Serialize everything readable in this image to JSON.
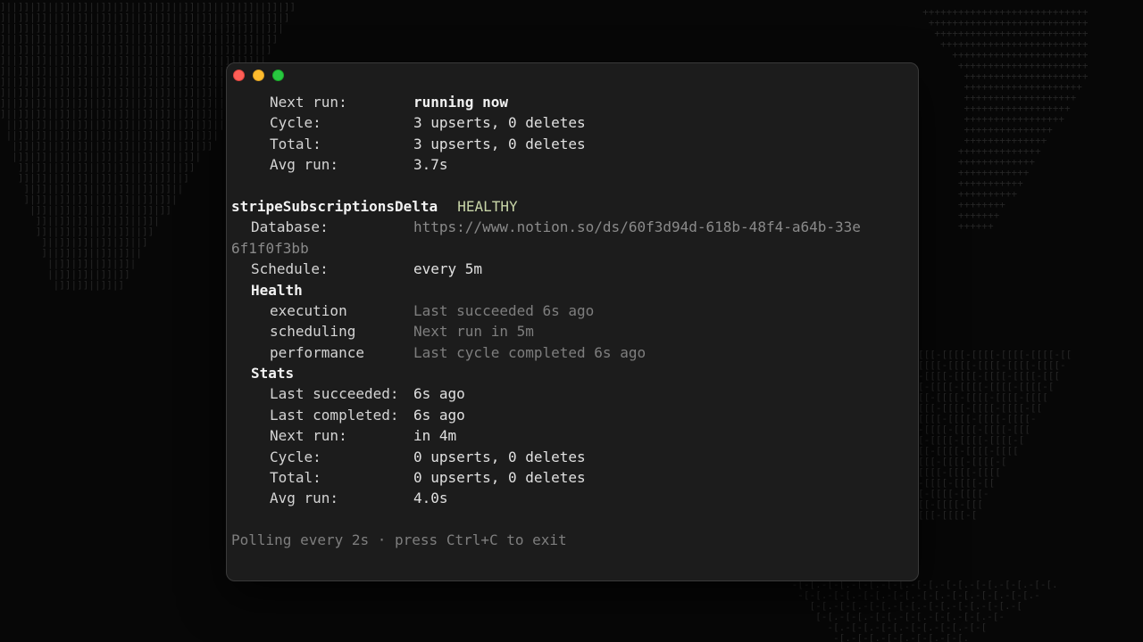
{
  "window": {
    "controls": [
      "close",
      "minimize",
      "zoom"
    ]
  },
  "prev_stats": {
    "next_run": {
      "key": "Next run:",
      "value": "running now"
    },
    "cycle": {
      "key": "Cycle:",
      "value": "3 upserts, 0 deletes"
    },
    "total": {
      "key": "Total:",
      "value": "3 upserts, 0 deletes"
    },
    "avg_run": {
      "key": "Avg run:",
      "value": "3.7s"
    }
  },
  "job": {
    "name": "stripeSubscriptionsDelta",
    "status": "HEALTHY",
    "status_color": "#c8d5a8",
    "database": {
      "key": "Database:",
      "url_line1": "https://www.notion.so/ds/60f3d94d-618b-48f4-a64b-33e",
      "url_line2": "6f1f0f3bb"
    },
    "schedule": {
      "key": "Schedule:",
      "value": "every 5m"
    },
    "health": {
      "heading": "Health",
      "execution": {
        "key": "execution",
        "value": "Last succeeded 6s ago"
      },
      "scheduling": {
        "key": "scheduling",
        "value": "Next run in 5m"
      },
      "performance": {
        "key": "performance",
        "value": "Last cycle completed 6s ago"
      }
    },
    "stats": {
      "heading": "Stats",
      "last_succeeded": {
        "key": "Last succeeded:",
        "value": "6s ago"
      },
      "last_completed": {
        "key": "Last completed:",
        "value": "6s ago"
      },
      "next_run": {
        "key": "Next run:",
        "value": "in 4m"
      },
      "cycle": {
        "key": "Cycle:",
        "value": "0 upserts, 0 deletes"
      },
      "total": {
        "key": "Total:",
        "value": "0 upserts, 0 deletes"
      },
      "avg_run": {
        "key": "Avg run:",
        "value": "4.0s"
      }
    }
  },
  "footer": "Polling every 2s · press Ctrl+C to exit",
  "colors": {
    "background": "#070707",
    "terminal_bg": "#1c1c1c",
    "text": "#d4d4d4",
    "dim_text": "#7e7e7e"
  }
}
